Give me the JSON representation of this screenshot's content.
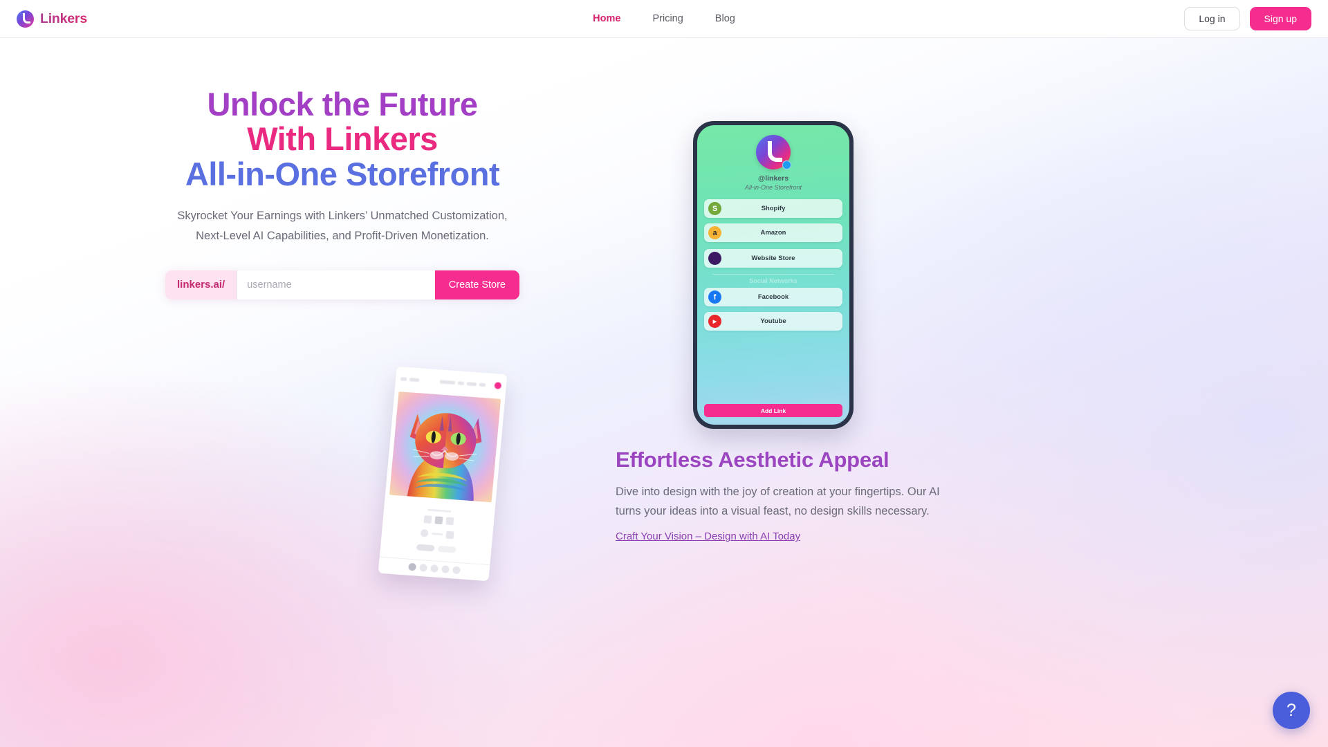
{
  "brand": {
    "name": "Linkers",
    "logo_icon": "linkers-logo-icon"
  },
  "nav": {
    "links": [
      {
        "label": "Home",
        "active": true
      },
      {
        "label": "Pricing",
        "active": false
      },
      {
        "label": "Blog",
        "active": false
      }
    ],
    "login_label": "Log in",
    "signup_label": "Sign up"
  },
  "hero": {
    "headline_line1": "Unlock the Future",
    "headline_line2": "With Linkers",
    "headline_line3": "All-in-One Storefront",
    "subhead": "Skyrocket Your Earnings with Linkers’ Unmatched Customization, Next-Level AI Capabilities, and Profit-Driven Monetization.",
    "form": {
      "prefix": "linkers.ai/",
      "input_value": "",
      "input_placeholder": "username",
      "submit_label": "Create Store"
    }
  },
  "phone_preview": {
    "handle": "@linkers",
    "tagline": "All-in-One Storefront",
    "section_label": "Social Networks",
    "add_link_label": "Add Link",
    "links": [
      {
        "label": "Shopify",
        "icon": "shopify-icon",
        "glyph": "S",
        "group": "stores"
      },
      {
        "label": "Amazon",
        "icon": "amazon-icon",
        "glyph": "a",
        "group": "stores"
      },
      {
        "label": "Website Store",
        "icon": "website-store-icon",
        "glyph": "",
        "group": "stores"
      },
      {
        "label": "Facebook",
        "icon": "facebook-icon",
        "glyph": "f",
        "group": "social"
      },
      {
        "label": "Youtube",
        "icon": "youtube-icon",
        "glyph": "▶",
        "group": "social"
      }
    ]
  },
  "feature": {
    "title": "Effortless Aesthetic Appeal",
    "body": "Dive into design with the joy of creation at your fingertips. Our AI turns your ideas into a visual feast, no design skills necessary.",
    "link_label": "Craft Your Vision – Design with AI Today"
  },
  "help": {
    "glyph": "?",
    "icon": "question-mark-icon"
  },
  "colors": {
    "accent_pink": "#f52d8e",
    "headline_purple": "#a23fc4",
    "headline_pink": "#ea2a80",
    "headline_blue": "#5a6fe0",
    "feature_purple": "#9b45c0",
    "help_blue": "#4a5ddb"
  }
}
